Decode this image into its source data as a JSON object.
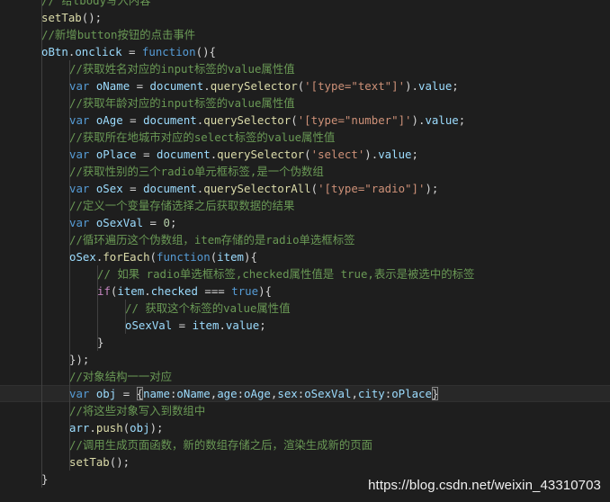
{
  "code": {
    "l0": {
      "c": "// 给tbody写入内容"
    },
    "l1": {
      "fn": "setTab",
      "p": "();"
    },
    "l2": {
      "c": "//新增button按钮的点击事件"
    },
    "l3": {
      "v1": "oBtn",
      "p1": ".",
      "v2": "onclick",
      "p2": " = ",
      "k": "function",
      "p3": "(){"
    },
    "l4": {
      "c": "//获取姓名对应的input标签的value属性值"
    },
    "l5": {
      "k": "var",
      "v": " oName",
      "p1": " = ",
      "o": "document",
      "p2": ".",
      "fn": "querySelector",
      "p3": "(",
      "s": "'[type=\"text\"]'",
      "p4": ").",
      "v2": "value",
      "p5": ";"
    },
    "l6": {
      "c": "//获取年龄对应的input标签的value属性值"
    },
    "l7": {
      "k": "var",
      "v": " oAge",
      "p1": " = ",
      "o": "document",
      "p2": ".",
      "fn": "querySelector",
      "p3": "(",
      "s": "'[type=\"number\"]'",
      "p4": ").",
      "v2": "value",
      "p5": ";"
    },
    "l8": {
      "c": "//获取所在地城市对应的select标签的value属性值"
    },
    "l9": {
      "k": "var",
      "v": " oPlace",
      "p1": " = ",
      "o": "document",
      "p2": ".",
      "fn": "querySelector",
      "p3": "(",
      "s": "'select'",
      "p4": ").",
      "v2": "value",
      "p5": ";"
    },
    "l10": {
      "c": "//获取性别的三个radio单元框标签,是一个伪数组"
    },
    "l11": {
      "k": "var",
      "v": " oSex",
      "p1": " = ",
      "o": "document",
      "p2": ".",
      "fn": "querySelectorAll",
      "p3": "(",
      "s": "'[type=\"radio\"]'",
      "p4": ");"
    },
    "l12": {
      "c": "//定义一个变量存储选择之后获取数据的结果"
    },
    "l13": {
      "k": "var",
      "v": " oSexVal",
      "p1": " = ",
      "n": "0",
      "p2": ";"
    },
    "l14": {
      "c": "//循环遍历这个伪数组，item存储的是radio单选框标签"
    },
    "l15": {
      "v1": "oSex",
      "p1": ".",
      "fn": "forEach",
      "p2": "(",
      "k": "function",
      "p3": "(",
      "v2": "item",
      "p4": "){"
    },
    "l16": {
      "c": "// 如果 radio单选框标签,checked属性值是 true,表示是被选中的标签"
    },
    "l17": {
      "kw": "if",
      "p1": "(",
      "v1": "item",
      "p2": ".",
      "v2": "checked",
      "p3": " === ",
      "k": "true",
      "p4": "){"
    },
    "l18": {
      "c": "// 获取这个标签的value属性值"
    },
    "l19": {
      "v1": "oSexVal",
      "p1": " = ",
      "v2": "item",
      "p2": ".",
      "v3": "value",
      "p3": ";"
    },
    "l20": {
      "p": "}"
    },
    "l21": {
      "p": "});"
    },
    "l22": {
      "c": "//对象结构一一对应"
    },
    "l23": {
      "k": "var",
      "v": " obj",
      "p1": " = ",
      "ob": "{",
      "n1": "name",
      "p2": ":",
      "v1": "oName",
      "p3": ",",
      "n2": "age",
      "p4": ":",
      "v2": "oAge",
      "p5": ",",
      "n3": "sex",
      "p6": ":",
      "v3": "oSexVal",
      "p7": ",",
      "n4": "city",
      "p8": ":",
      "v4": "oPlace",
      "cb": "}"
    },
    "l24": {
      "c": "//将这些对象写入到数组中"
    },
    "l25": {
      "v1": "arr",
      "p1": ".",
      "fn": "push",
      "p2": "(",
      "v2": "obj",
      "p3": ");"
    },
    "l26": {
      "c": "//调用生成页面函数，新的数组存储之后，渲染生成新的页面"
    },
    "l27": {
      "fn": "setTab",
      "p": "();"
    },
    "l28": {
      "p": "}"
    }
  },
  "watermark": "https://blog.csdn.net/weixin_43310703",
  "colors": {
    "background": "#1e1e1e",
    "comment": "#6a9955",
    "keyword": "#569cd6",
    "variable": "#9cdcfe",
    "function": "#dcdcaa",
    "string": "#ce9178",
    "number": "#b5cea8",
    "control": "#c586c0",
    "punctuation": "#d4d4d4"
  }
}
